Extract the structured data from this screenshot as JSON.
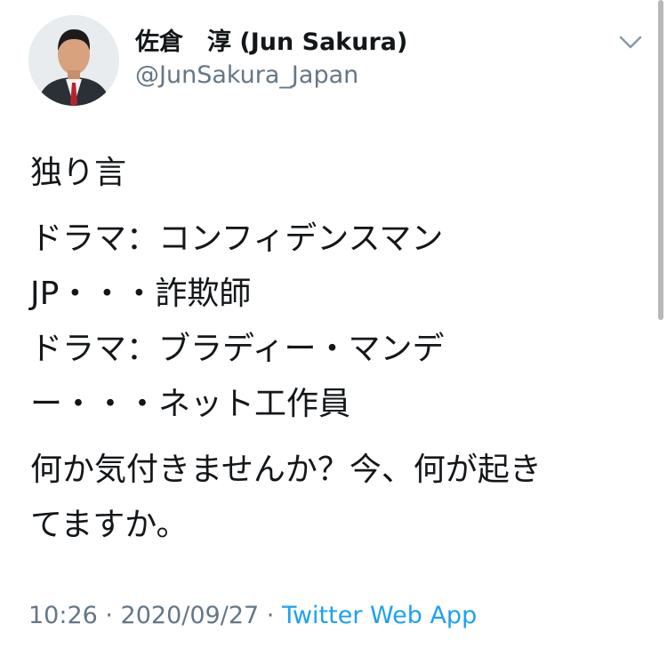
{
  "tweet": {
    "author": {
      "display_name": "佐倉　淳 (Jun Sakura)",
      "handle": "@JunSakura_Japan"
    },
    "text_paragraphs": [
      [
        "独り言"
      ],
      [
        "ドラマ：コンフィデンスマン",
        "JP・・・詐欺師",
        "ドラマ：ブラディー・マンデ",
        "ー・・・ネット工作員"
      ],
      [
        "何か気付きませんか？今、何が起き",
        "てますか。"
      ]
    ],
    "timestamp": "10:26 · 2020/09/27 · ",
    "source": "Twitter Web App"
  },
  "icons": {
    "menu": "chevron-down-icon"
  },
  "colors": {
    "text_primary": "#14171a",
    "text_secondary": "#657786",
    "link": "#1da1f2"
  }
}
